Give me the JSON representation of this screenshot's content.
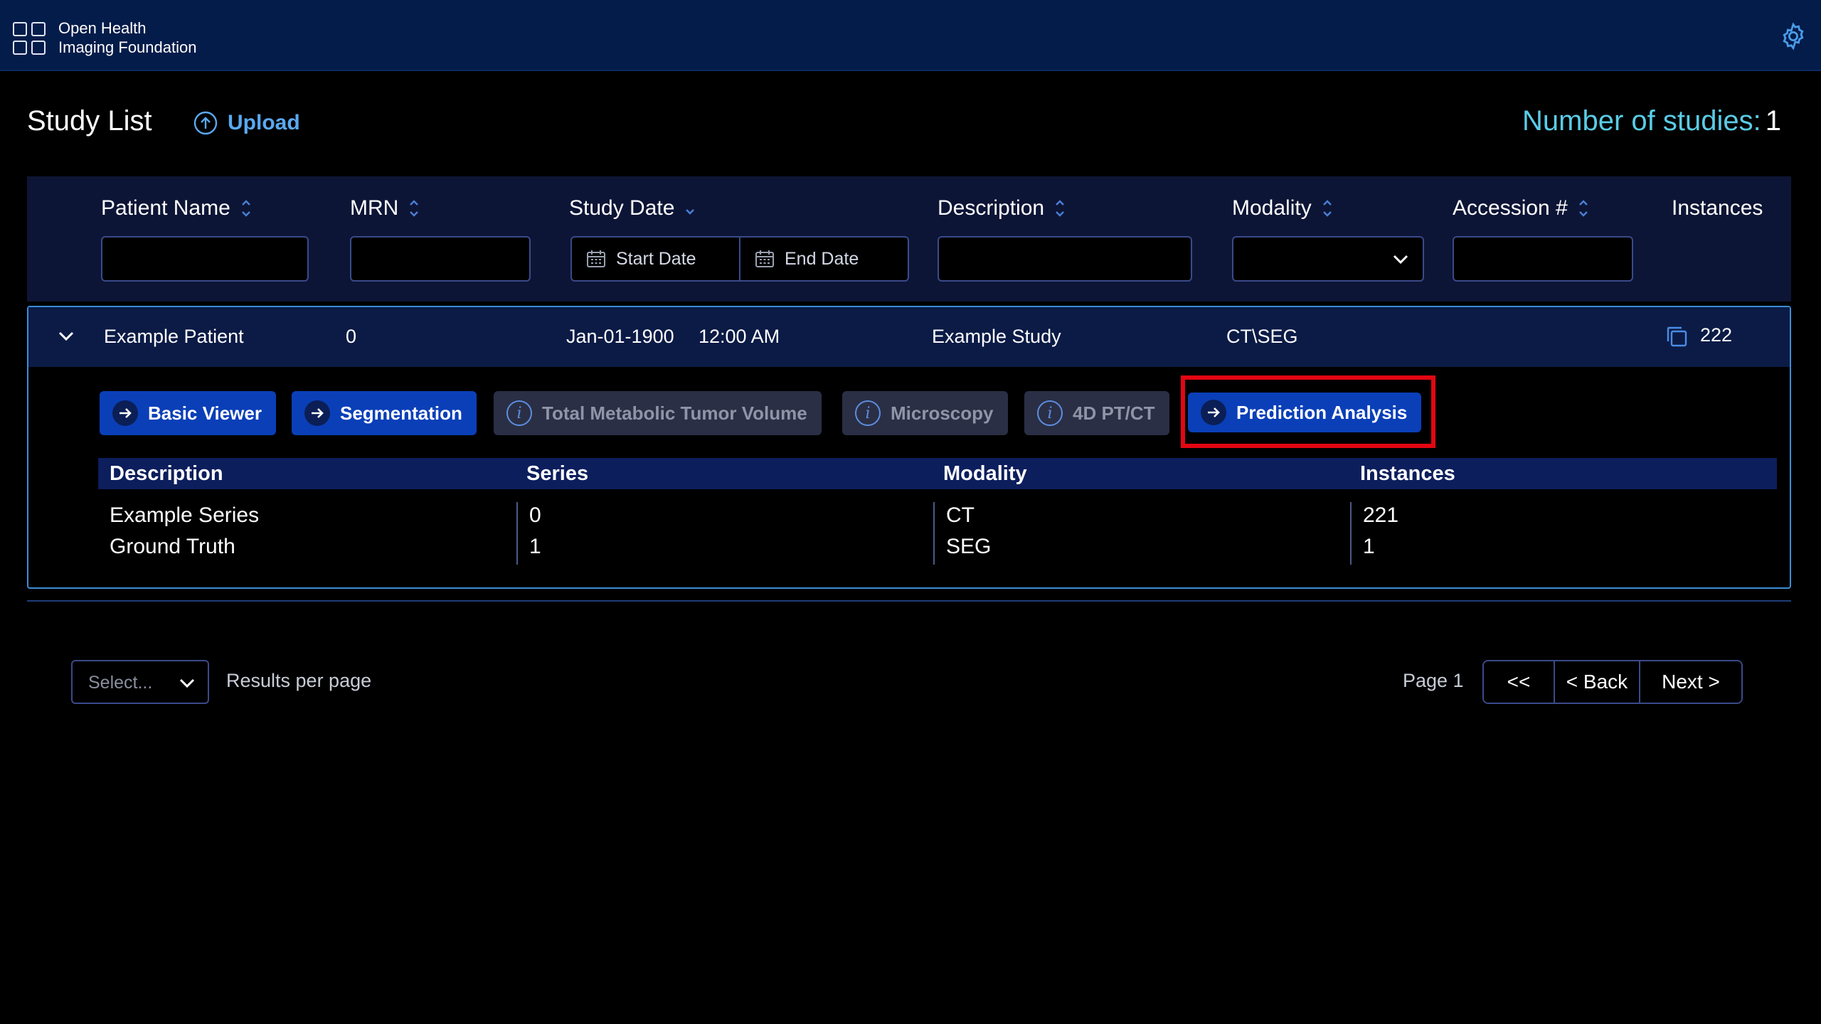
{
  "header": {
    "brand_line1": "Open Health",
    "brand_line2": "Imaging Foundation",
    "logo_icon": "ohif-logo-icon",
    "settings_icon": "gear-icon"
  },
  "page": {
    "title": "Study List",
    "upload_label": "Upload",
    "count_label": "Number of studies:",
    "count_value": "1"
  },
  "filters": {
    "columns": [
      "Patient Name",
      "MRN",
      "Study Date",
      "Description",
      "Modality",
      "Accession #",
      "Instances"
    ],
    "start_date_placeholder": "Start Date",
    "end_date_placeholder": "End Date"
  },
  "study": {
    "patient_name": "Example Patient",
    "mrn": "0",
    "date": "Jan-01-1900",
    "time": "12:00 AM",
    "description": "Example Study",
    "modality": "CT\\SEG",
    "instances": "222"
  },
  "modes": [
    {
      "label": "Basic Viewer",
      "enabled": true
    },
    {
      "label": "Segmentation",
      "enabled": true
    },
    {
      "label": "Total Metabolic Tumor Volume",
      "enabled": false
    },
    {
      "label": "Microscopy",
      "enabled": false
    },
    {
      "label": "4D PT/CT",
      "enabled": false
    },
    {
      "label": "Prediction Analysis",
      "enabled": true,
      "highlighted": true
    }
  ],
  "series": {
    "headers": [
      "Description",
      "Series",
      "Modality",
      "Instances"
    ],
    "rows": [
      {
        "description": "Example Series",
        "series": "0",
        "modality": "CT",
        "instances": "221"
      },
      {
        "description": "Ground Truth",
        "series": "1",
        "modality": "SEG",
        "instances": "1"
      }
    ]
  },
  "pagination": {
    "per_page_placeholder": "Select...",
    "results_per_page": "Results per page",
    "page_label": "Page 1",
    "first": "<<",
    "back": "< Back",
    "next": "Next >"
  },
  "colors": {
    "topbar": "#041c4a",
    "accent": "#5acce6",
    "primary_button": "#0a3fb8",
    "highlight": "#e30613"
  }
}
